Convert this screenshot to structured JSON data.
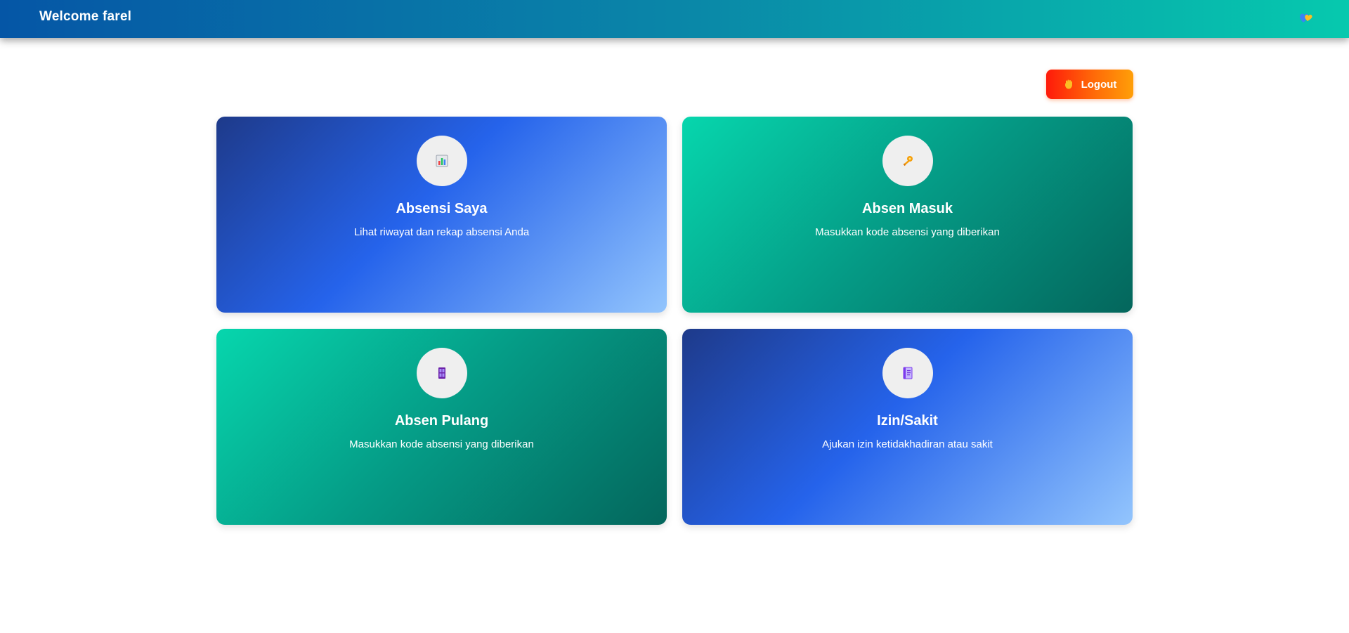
{
  "header": {
    "title": "Welcome farel",
    "icon": "hearts-icon"
  },
  "logout": {
    "label": "Logout",
    "icon": "waving-hand-icon"
  },
  "cards": [
    {
      "title": "Absensi Saya",
      "description": "Lihat riwayat dan rekap absensi Anda",
      "icon": "bar-chart-icon",
      "theme": "blue"
    },
    {
      "title": "Absen Masuk",
      "description": "Masukkan kode absensi yang diberikan",
      "icon": "key-icon",
      "theme": "green"
    },
    {
      "title": "Absen Pulang",
      "description": "Masukkan kode absensi yang diberikan",
      "icon": "door-icon",
      "theme": "green"
    },
    {
      "title": "Izin/Sakit",
      "description": "Ajukan izin ketidakhadiran atau sakit",
      "icon": "notebook-icon",
      "theme": "blue"
    }
  ],
  "colors": {
    "nav_start": "#0556a6",
    "nav_end": "#06c9ae",
    "logout_start": "#ff1a0a",
    "logout_end": "#ff9f08",
    "card_blue_start": "#1e3a8a",
    "card_blue_end": "#93c5fd",
    "card_green_start": "#06d6ad",
    "card_green_end": "#04665c"
  }
}
